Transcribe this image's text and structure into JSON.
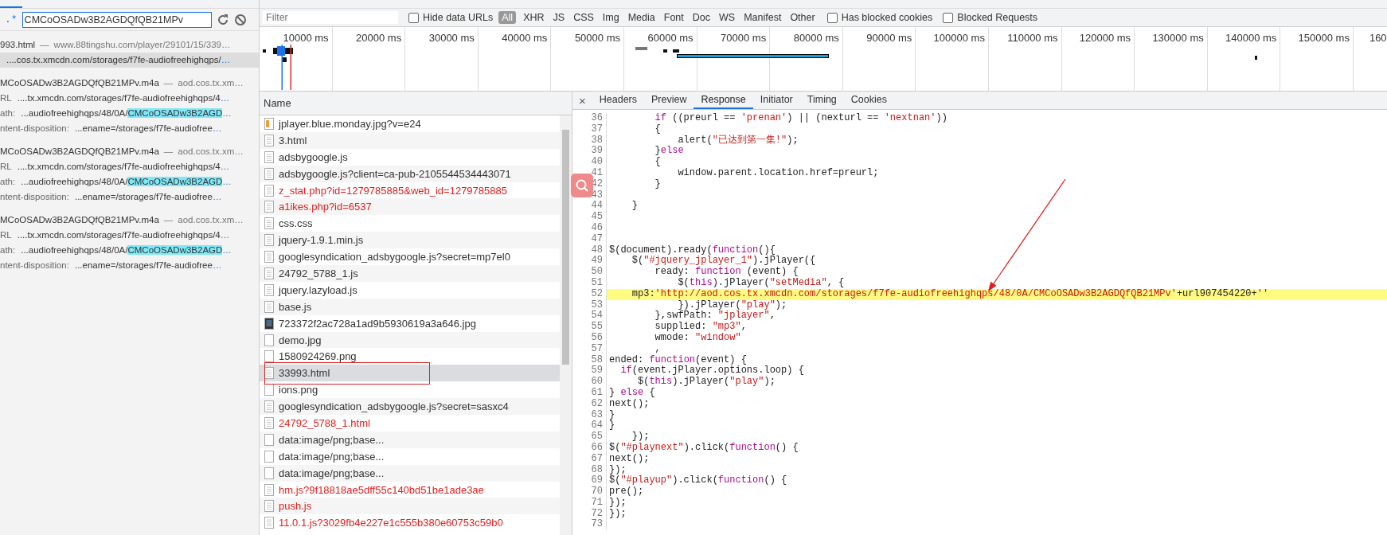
{
  "search_panel": {
    "regex_toggle": {
      "label": ".*",
      "on": true
    },
    "query": "CMCoOSADw3B2AGDQfQB21MPv",
    "results": [
      {
        "file": "993.html",
        "separator": "—",
        "source": "www.88tingshu.com/player/29101/15/339…",
        "matches": [
          {
            "text": "....cos.tx.xmcdn.com/storages/f7fe-audiofreehighqps/",
            "more": "…",
            "selected": true
          }
        ]
      },
      {
        "file": "MCoOSADw3B2AGDQfQB21MPv.m4a",
        "separator": "—",
        "source": "aod.cos.tx.xm…",
        "matches": [
          {
            "label": "RL",
            "text": "....tx.xmcdn.com/storages/f7fe-audiofreehighqps/4",
            "more": "…",
            "selected": false
          },
          {
            "label": "ath:",
            "text": "...audiofreehighqps/48/0A/",
            "match": "CMCoOSADw3B2AGD",
            "more": "…",
            "selected": false
          },
          {
            "label": "ntent-disposition:",
            "text": "...ename=/storages/f7fe-audiofree",
            "more": "…",
            "selected": false
          }
        ]
      },
      {
        "file": "MCoOSADw3B2AGDQfQB21MPv.m4a",
        "separator": "—",
        "source": "aod.cos.tx.xm…",
        "matches": [
          {
            "label": "RL",
            "text": "....tx.xmcdn.com/storages/f7fe-audiofreehighqps/4",
            "more": "…",
            "selected": false
          },
          {
            "label": "ath:",
            "text": "...audiofreehighqps/48/0A/",
            "match": "CMCoOSADw3B2AGD",
            "more": "…",
            "selected": false
          },
          {
            "label": "ntent-disposition:",
            "text": "...ename=/storages/f7fe-audiofree",
            "more": "…",
            "selected": false
          }
        ]
      },
      {
        "file": "MCoOSADw3B2AGDQfQB21MPv.m4a",
        "separator": "—",
        "source": "aod.cos.tx.xm…",
        "matches": [
          {
            "label": "RL",
            "text": "....tx.xmcdn.com/storages/f7fe-audiofreehighqps/4",
            "more": "…",
            "selected": false
          },
          {
            "label": "ath:",
            "text": "...audiofreehighqps/48/0A/",
            "match": "CMCoOSADw3B2AGD",
            "more": "…",
            "selected": false
          },
          {
            "label": "ntent-disposition:",
            "text": "...ename=/storages/f7fe-audiofree",
            "more": "…",
            "selected": false
          }
        ]
      }
    ]
  },
  "filter_bar": {
    "placeholder": "Filter",
    "hide_data_urls": {
      "label": "Hide data URLs",
      "checked": false
    },
    "types": [
      {
        "label": "All",
        "selected": true
      },
      {
        "label": "XHR",
        "selected": false
      },
      {
        "label": "JS",
        "selected": false
      },
      {
        "label": "CSS",
        "selected": false
      },
      {
        "label": "Img",
        "selected": false
      },
      {
        "label": "Media",
        "selected": false
      },
      {
        "label": "Font",
        "selected": false
      },
      {
        "label": "Doc",
        "selected": false
      },
      {
        "label": "WS",
        "selected": false
      },
      {
        "label": "Manifest",
        "selected": false
      },
      {
        "label": "Other",
        "selected": false
      }
    ],
    "extra_checks": [
      {
        "label": "Has blocked cookies",
        "checked": false
      },
      {
        "label": "Blocked Requests",
        "checked": false
      }
    ]
  },
  "timeline": {
    "ticks": [
      "10000 ms",
      "20000 ms",
      "30000 ms",
      "40000 ms",
      "50000 ms",
      "60000 ms",
      "70000 ms",
      "80000 ms",
      "90000 ms",
      "100000 ms",
      "110000 ms",
      "120000 ms",
      "130000 ms",
      "140000 ms",
      "150000 ms",
      "160"
    ]
  },
  "requests": {
    "column": "Name",
    "rows": [
      {
        "name": "jplayer.blue.monday.jpg?v=e24",
        "kind": "thumb",
        "failed": false,
        "selected": false
      },
      {
        "name": "3.html",
        "kind": "doc",
        "failed": false,
        "selected": false
      },
      {
        "name": "adsbygoogle.js",
        "kind": "doc",
        "failed": false,
        "selected": false
      },
      {
        "name": "adsbygoogle.js?client=ca-pub-2105544534443071",
        "kind": "doc",
        "failed": false,
        "selected": false
      },
      {
        "name": "z_stat.php?id=1279785885&web_id=1279785885",
        "kind": "doc",
        "failed": true,
        "selected": false
      },
      {
        "name": "a1ikes.php?id=6537",
        "kind": "doc",
        "failed": true,
        "selected": false
      },
      {
        "name": "css.css",
        "kind": "doc",
        "failed": false,
        "selected": false
      },
      {
        "name": "jquery-1.9.1.min.js",
        "kind": "doc",
        "failed": false,
        "selected": false
      },
      {
        "name": "googlesyndication_adsbygoogle.js?secret=mp7el0",
        "kind": "doc",
        "failed": false,
        "selected": false
      },
      {
        "name": "24792_5788_1.js",
        "kind": "doc",
        "failed": false,
        "selected": false
      },
      {
        "name": "jquery.lazyload.js",
        "kind": "doc",
        "failed": false,
        "selected": false
      },
      {
        "name": "base.js",
        "kind": "doc",
        "failed": false,
        "selected": false
      },
      {
        "name": "723372f2ac728a1ad9b5930619a3a646.jpg",
        "kind": "photo",
        "failed": false,
        "selected": false
      },
      {
        "name": "demo.jpg",
        "kind": "blank",
        "failed": false,
        "selected": false
      },
      {
        "name": "1580924269.png",
        "kind": "blank",
        "failed": false,
        "selected": false
      },
      {
        "name": "33993.html",
        "kind": "doc",
        "failed": false,
        "selected": true
      },
      {
        "name": "ions.png",
        "kind": "blank",
        "failed": false,
        "selected": false
      },
      {
        "name": "googlesyndication_adsbygoogle.js?secret=sasxc4",
        "kind": "doc",
        "failed": false,
        "selected": false
      },
      {
        "name": "24792_5788_1.html",
        "kind": "doc",
        "failed": true,
        "selected": false
      },
      {
        "name": "data:image/png;base...",
        "kind": "blank",
        "failed": false,
        "selected": false
      },
      {
        "name": "data:image/png;base...",
        "kind": "blank",
        "failed": false,
        "selected": false
      },
      {
        "name": "data:image/png;base...",
        "kind": "blank",
        "failed": false,
        "selected": false
      },
      {
        "name": "hm.js?9f18818ae5dff55c140bd51be1ade3ae",
        "kind": "doc",
        "failed": true,
        "selected": false
      },
      {
        "name": "push.js",
        "kind": "doc",
        "failed": true,
        "selected": false
      },
      {
        "name": "11.0.1.js?3029fb4e227e1c555b380e60753c59b0",
        "kind": "doc",
        "failed": true,
        "selected": false
      }
    ]
  },
  "details": {
    "close": "×",
    "tabs": [
      {
        "label": "Headers",
        "selected": false
      },
      {
        "label": "Preview",
        "selected": false
      },
      {
        "label": "Response",
        "selected": true
      },
      {
        "label": "Initiator",
        "selected": false
      },
      {
        "label": "Timing",
        "selected": false
      },
      {
        "label": "Cookies",
        "selected": false
      }
    ],
    "code": [
      {
        "n": "36",
        "highlighted": false,
        "segs": [
          {
            "kind": "k",
            "text": "        if"
          },
          {
            "kind": "p",
            "text": " ((preurl == "
          },
          {
            "kind": "s",
            "text": "'prenan'"
          },
          {
            "kind": "p",
            "text": ") || (nexturl == "
          },
          {
            "kind": "s",
            "text": "'nextnan'"
          },
          {
            "kind": "p",
            "text": "))"
          }
        ]
      },
      {
        "n": "37",
        "highlighted": false,
        "segs": [
          {
            "kind": "p",
            "text": "        {"
          }
        ]
      },
      {
        "n": "38",
        "highlighted": false,
        "segs": [
          {
            "kind": "p",
            "text": "            alert("
          },
          {
            "kind": "s",
            "text": "\"已达到第一集!\""
          },
          {
            "kind": "p",
            "text": ");"
          }
        ]
      },
      {
        "n": "39",
        "highlighted": false,
        "segs": [
          {
            "kind": "p",
            "text": "        }"
          },
          {
            "kind": "k",
            "text": "else"
          }
        ]
      },
      {
        "n": "40",
        "highlighted": false,
        "segs": [
          {
            "kind": "p",
            "text": "        {"
          }
        ]
      },
      {
        "n": "41",
        "highlighted": false,
        "segs": [
          {
            "kind": "p",
            "text": "            window.parent.location.href=preurl;"
          }
        ]
      },
      {
        "n": "42",
        "highlighted": false,
        "segs": [
          {
            "kind": "p",
            "text": "        }"
          }
        ]
      },
      {
        "n": "43",
        "highlighted": false
      },
      {
        "n": "44",
        "highlighted": false,
        "segs": [
          {
            "kind": "p",
            "text": "    }"
          }
        ]
      },
      {
        "n": "45",
        "highlighted": false
      },
      {
        "n": "46",
        "highlighted": false
      },
      {
        "n": "47",
        "highlighted": false
      },
      {
        "n": "48",
        "highlighted": false,
        "segs": [
          {
            "kind": "p",
            "text": "$(document).ready("
          },
          {
            "kind": "k",
            "text": "function"
          },
          {
            "kind": "p",
            "text": "(){"
          }
        ]
      },
      {
        "n": "49",
        "highlighted": false,
        "segs": [
          {
            "kind": "p",
            "text": "    $("
          },
          {
            "kind": "s",
            "text": "\"#jquery_jplayer_1\""
          },
          {
            "kind": "p",
            "text": ").jPlayer({"
          }
        ]
      },
      {
        "n": "50",
        "highlighted": false,
        "segs": [
          {
            "kind": "p",
            "text": "        ready: "
          },
          {
            "kind": "k",
            "text": "function"
          },
          {
            "kind": "p",
            "text": " (event) {"
          }
        ]
      },
      {
        "n": "51",
        "highlighted": false,
        "segs": [
          {
            "kind": "p",
            "text": "            $("
          },
          {
            "kind": "k",
            "text": "this"
          },
          {
            "kind": "p",
            "text": ").jPlayer("
          },
          {
            "kind": "s",
            "text": "\"setMedia\""
          },
          {
            "kind": "p",
            "text": ", {"
          }
        ]
      },
      {
        "n": "52",
        "highlighted": true,
        "segs": [
          {
            "kind": "p",
            "text": "    mp3:"
          },
          {
            "kind": "s",
            "text": "'http://aod.cos.tx.xmcdn.com/storages/f7fe-audiofreehighqps/48/0A/CMCoOSADw3B2AGDQfQB21MPv'"
          },
          {
            "kind": "p",
            "text": "+url907454220+"
          },
          {
            "kind": "s",
            "text": "''"
          }
        ]
      },
      {
        "n": "53",
        "highlighted": false,
        "segs": [
          {
            "kind": "p",
            "text": "            }).jPlayer("
          },
          {
            "kind": "s",
            "text": "\"play\""
          },
          {
            "kind": "p",
            "text": ");"
          }
        ]
      },
      {
        "n": "54",
        "highlighted": false,
        "segs": [
          {
            "kind": "p",
            "text": "        },swfPath: "
          },
          {
            "kind": "s",
            "text": "\"jplayer\""
          },
          {
            "kind": "p",
            "text": ","
          }
        ]
      },
      {
        "n": "55",
        "highlighted": false,
        "segs": [
          {
            "kind": "p",
            "text": "        supplied: "
          },
          {
            "kind": "s",
            "text": "\"mp3\""
          },
          {
            "kind": "p",
            "text": ","
          }
        ]
      },
      {
        "n": "56",
        "highlighted": false,
        "segs": [
          {
            "kind": "p",
            "text": "        wmode: "
          },
          {
            "kind": "s",
            "text": "\"window\""
          }
        ]
      },
      {
        "n": "57",
        "highlighted": false,
        "segs": [
          {
            "kind": "p",
            "text": "        ,"
          }
        ]
      },
      {
        "n": "58",
        "highlighted": false,
        "segs": [
          {
            "kind": "p",
            "text": "ended: "
          },
          {
            "kind": "k",
            "text": "function"
          },
          {
            "kind": "p",
            "text": "(event) {"
          }
        ]
      },
      {
        "n": "59",
        "highlighted": false,
        "segs": [
          {
            "kind": "k",
            "text": "  if"
          },
          {
            "kind": "p",
            "text": "(event.jPlayer.options.loop) {"
          }
        ]
      },
      {
        "n": "60",
        "highlighted": false,
        "segs": [
          {
            "kind": "p",
            "text": "     $("
          },
          {
            "kind": "k",
            "text": "this"
          },
          {
            "kind": "p",
            "text": ").jPlayer("
          },
          {
            "kind": "s",
            "text": "\"play\""
          },
          {
            "kind": "p",
            "text": ");"
          }
        ]
      },
      {
        "n": "61",
        "highlighted": false,
        "segs": [
          {
            "kind": "p",
            "text": "} "
          },
          {
            "kind": "k",
            "text": "else"
          },
          {
            "kind": "p",
            "text": " {"
          }
        ]
      },
      {
        "n": "62",
        "highlighted": false,
        "segs": [
          {
            "kind": "p",
            "text": "next();"
          }
        ]
      },
      {
        "n": "63",
        "highlighted": false,
        "segs": [
          {
            "kind": "p",
            "text": "}"
          }
        ]
      },
      {
        "n": "64",
        "highlighted": false,
        "segs": [
          {
            "kind": "p",
            "text": "}"
          }
        ]
      },
      {
        "n": "65",
        "highlighted": false,
        "segs": [
          {
            "kind": "p",
            "text": "    });"
          }
        ]
      },
      {
        "n": "66",
        "highlighted": false,
        "segs": [
          {
            "kind": "p",
            "text": "$("
          },
          {
            "kind": "s",
            "text": "\"#playnext\""
          },
          {
            "kind": "p",
            "text": ").click("
          },
          {
            "kind": "k",
            "text": "function"
          },
          {
            "kind": "p",
            "text": "() {"
          }
        ]
      },
      {
        "n": "67",
        "highlighted": false,
        "segs": [
          {
            "kind": "p",
            "text": "next();"
          }
        ]
      },
      {
        "n": "68",
        "highlighted": false,
        "segs": [
          {
            "kind": "p",
            "text": "});"
          }
        ]
      },
      {
        "n": "69",
        "highlighted": false,
        "segs": [
          {
            "kind": "p",
            "text": "$("
          },
          {
            "kind": "s",
            "text": "\"#playup\""
          },
          {
            "kind": "p",
            "text": ").click("
          },
          {
            "kind": "k",
            "text": "function"
          },
          {
            "kind": "p",
            "text": "() {"
          }
        ]
      },
      {
        "n": "70",
        "highlighted": false,
        "segs": [
          {
            "kind": "p",
            "text": "pre();"
          }
        ]
      },
      {
        "n": "71",
        "highlighted": false,
        "segs": [
          {
            "kind": "p",
            "text": "});"
          }
        ]
      },
      {
        "n": "72",
        "highlighted": false,
        "segs": [
          {
            "kind": "p",
            "text": "});"
          }
        ]
      },
      {
        "n": "73",
        "highlighted": false
      }
    ]
  }
}
